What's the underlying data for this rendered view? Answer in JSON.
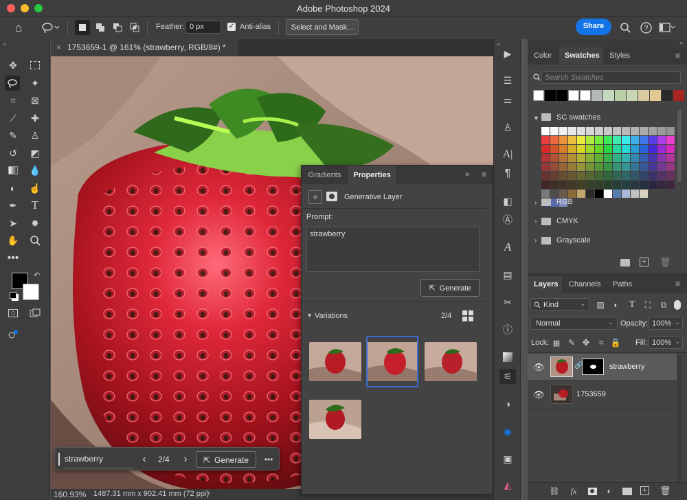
{
  "app": {
    "title": "Adobe Photoshop 2024"
  },
  "colors": {
    "accent": "#1473e6",
    "selection": "#3c6fd1"
  },
  "options_bar": {
    "feather_label": "Feather:",
    "feather_value": "0 px",
    "antialias_label": "Anti-alias",
    "select_mask_label": "Select and Mask...",
    "share_label": "Share"
  },
  "document": {
    "tab_title": "1753659-1 @ 161% (strawberry, RGB/8#) *",
    "zoom": "160.93%",
    "dimensions": "1487.31 mm x 902.41 mm (72 ppi)"
  },
  "gen_fill_bar": {
    "prompt_value": "strawberry",
    "counter": "2/4",
    "generate_label": "Generate"
  },
  "properties_panel": {
    "tab_gradients": "Gradients",
    "tab_properties": "Properties",
    "layer_type": "Generative Layer",
    "prompt_label": "Prompt:",
    "prompt_value": "strawberry",
    "generate_label": "Generate",
    "variations_label": "Variations",
    "variations_count": "2/4"
  },
  "swatches_panel": {
    "tabs": [
      "Color",
      "Swatches",
      "Styles"
    ],
    "search_placeholder": "Search Swatches",
    "recent": [
      "#ffffff",
      "#000000",
      "#000000",
      "#ffffff",
      "#ffffff",
      "#b5b8b9",
      "#c6d8bd",
      "#b9cfa6",
      "#c8d6b5",
      "#d8c9a0",
      "#e2c992",
      "#2a2a2a",
      "#a8261f"
    ],
    "folders": [
      "SC swatches",
      "RGB",
      "CMYK",
      "Grayscale"
    ]
  },
  "layers_panel": {
    "tabs": [
      "Layers",
      "Channels",
      "Paths"
    ],
    "kind_label": "Kind",
    "blend_mode": "Normal",
    "opacity_label": "Opacity:",
    "opacity_value": "100%",
    "lock_label": "Lock:",
    "fill_label": "Fill:",
    "fill_value": "100%",
    "layers": [
      {
        "name": "strawberry",
        "selected": true
      },
      {
        "name": "1753659",
        "selected": false
      }
    ]
  }
}
